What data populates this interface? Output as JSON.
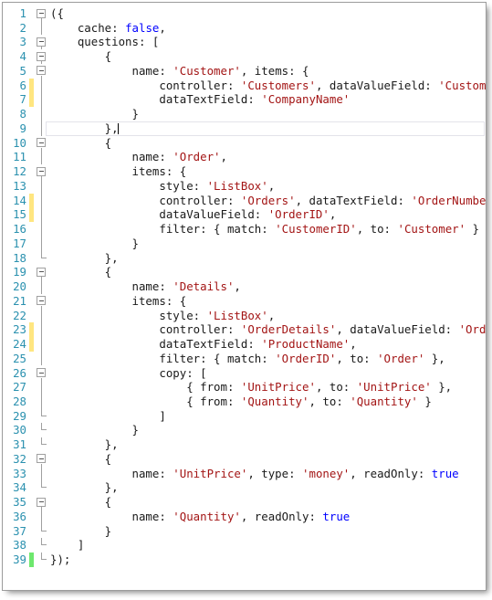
{
  "editor": {
    "language": "javascript",
    "colors": {
      "line_number": "#2b91af",
      "string": "#a31515",
      "keyword": "#0000ff",
      "plain": "#1a1a1a",
      "change_modified": "#ffe680",
      "change_saved": "#6ee86e",
      "current_line_border": "#e3e3ea",
      "background": "#ffffff"
    },
    "cursor": {
      "line": 9,
      "column": 11
    },
    "lines": [
      {
        "n": 1,
        "fold": "box",
        "change": "none",
        "tokens": [
          {
            "t": "({",
            "c": "pl"
          }
        ]
      },
      {
        "n": 2,
        "fold": "line",
        "change": "none",
        "tokens": [
          {
            "t": "    cache: ",
            "c": "pl"
          },
          {
            "t": "false",
            "c": "kw"
          },
          {
            "t": ",",
            "c": "pl"
          }
        ]
      },
      {
        "n": 3,
        "fold": "box",
        "change": "none",
        "tokens": [
          {
            "t": "    questions: [",
            "c": "pl"
          }
        ]
      },
      {
        "n": 4,
        "fold": "box",
        "change": "none",
        "tokens": [
          {
            "t": "        {",
            "c": "pl"
          }
        ]
      },
      {
        "n": 5,
        "fold": "box",
        "change": "none",
        "tokens": [
          {
            "t": "            name: ",
            "c": "pl"
          },
          {
            "t": "'Customer'",
            "c": "str"
          },
          {
            "t": ", items: {",
            "c": "pl"
          }
        ]
      },
      {
        "n": 6,
        "fold": "line",
        "change": "modified",
        "tokens": [
          {
            "t": "                controller: ",
            "c": "pl"
          },
          {
            "t": "'Customers'",
            "c": "str"
          },
          {
            "t": ", dataValueField: ",
            "c": "pl"
          },
          {
            "t": "'CustomerID'",
            "c": "str"
          },
          {
            "t": ",",
            "c": "pl"
          }
        ]
      },
      {
        "n": 7,
        "fold": "line",
        "change": "modified",
        "tokens": [
          {
            "t": "                dataTextField: ",
            "c": "pl"
          },
          {
            "t": "'CompanyName'",
            "c": "str"
          }
        ]
      },
      {
        "n": 8,
        "fold": "line",
        "change": "none",
        "tokens": [
          {
            "t": "            }",
            "c": "pl"
          }
        ]
      },
      {
        "n": 9,
        "fold": "line",
        "change": "none",
        "current": true,
        "tokens": [
          {
            "t": "        },",
            "c": "pl"
          }
        ]
      },
      {
        "n": 10,
        "fold": "box",
        "change": "none",
        "tokens": [
          {
            "t": "        {",
            "c": "pl"
          }
        ]
      },
      {
        "n": 11,
        "fold": "line",
        "change": "none",
        "tokens": [
          {
            "t": "            name: ",
            "c": "pl"
          },
          {
            "t": "'Order'",
            "c": "str"
          },
          {
            "t": ",",
            "c": "pl"
          }
        ]
      },
      {
        "n": 12,
        "fold": "box",
        "change": "none",
        "tokens": [
          {
            "t": "            items: {",
            "c": "pl"
          }
        ]
      },
      {
        "n": 13,
        "fold": "line",
        "change": "none",
        "tokens": [
          {
            "t": "                style: ",
            "c": "pl"
          },
          {
            "t": "'ListBox'",
            "c": "str"
          },
          {
            "t": ",",
            "c": "pl"
          }
        ]
      },
      {
        "n": 14,
        "fold": "line",
        "change": "modified",
        "tokens": [
          {
            "t": "                controller: ",
            "c": "pl"
          },
          {
            "t": "'Orders'",
            "c": "str"
          },
          {
            "t": ", dataTextField: ",
            "c": "pl"
          },
          {
            "t": "'OrderNumber'",
            "c": "str"
          },
          {
            "t": ",",
            "c": "pl"
          }
        ]
      },
      {
        "n": 15,
        "fold": "line",
        "change": "modified",
        "tokens": [
          {
            "t": "                dataValueField: ",
            "c": "pl"
          },
          {
            "t": "'OrderID'",
            "c": "str"
          },
          {
            "t": ",",
            "c": "pl"
          }
        ]
      },
      {
        "n": 16,
        "fold": "line",
        "change": "none",
        "tokens": [
          {
            "t": "                filter: { match: ",
            "c": "pl"
          },
          {
            "t": "'CustomerID'",
            "c": "str"
          },
          {
            "t": ", to: ",
            "c": "pl"
          },
          {
            "t": "'Customer'",
            "c": "str"
          },
          {
            "t": " }",
            "c": "pl"
          }
        ]
      },
      {
        "n": 17,
        "fold": "line",
        "change": "none",
        "tokens": [
          {
            "t": "            }",
            "c": "pl"
          }
        ]
      },
      {
        "n": 18,
        "fold": "end",
        "change": "none",
        "tokens": [
          {
            "t": "        },",
            "c": "pl"
          }
        ]
      },
      {
        "n": 19,
        "fold": "box",
        "change": "none",
        "tokens": [
          {
            "t": "        {",
            "c": "pl"
          }
        ]
      },
      {
        "n": 20,
        "fold": "line",
        "change": "none",
        "tokens": [
          {
            "t": "            name: ",
            "c": "pl"
          },
          {
            "t": "'Details'",
            "c": "str"
          },
          {
            "t": ",",
            "c": "pl"
          }
        ]
      },
      {
        "n": 21,
        "fold": "box",
        "change": "none",
        "tokens": [
          {
            "t": "            items: {",
            "c": "pl"
          }
        ]
      },
      {
        "n": 22,
        "fold": "line",
        "change": "none",
        "tokens": [
          {
            "t": "                style: ",
            "c": "pl"
          },
          {
            "t": "'ListBox'",
            "c": "str"
          },
          {
            "t": ",",
            "c": "pl"
          }
        ]
      },
      {
        "n": 23,
        "fold": "line",
        "change": "modified",
        "tokens": [
          {
            "t": "                controller: ",
            "c": "pl"
          },
          {
            "t": "'OrderDetails'",
            "c": "str"
          },
          {
            "t": ", dataValueField: ",
            "c": "pl"
          },
          {
            "t": "'OrderID'",
            "c": "str"
          },
          {
            "t": ",",
            "c": "pl"
          }
        ]
      },
      {
        "n": 24,
        "fold": "line",
        "change": "modified",
        "tokens": [
          {
            "t": "                dataTextField: ",
            "c": "pl"
          },
          {
            "t": "'ProductName'",
            "c": "str"
          },
          {
            "t": ",",
            "c": "pl"
          }
        ]
      },
      {
        "n": 25,
        "fold": "line",
        "change": "none",
        "tokens": [
          {
            "t": "                filter: { match: ",
            "c": "pl"
          },
          {
            "t": "'OrderID'",
            "c": "str"
          },
          {
            "t": ", to: ",
            "c": "pl"
          },
          {
            "t": "'Order'",
            "c": "str"
          },
          {
            "t": " },",
            "c": "pl"
          }
        ]
      },
      {
        "n": 26,
        "fold": "box",
        "change": "none",
        "tokens": [
          {
            "t": "                copy: [",
            "c": "pl"
          }
        ]
      },
      {
        "n": 27,
        "fold": "line",
        "change": "none",
        "tokens": [
          {
            "t": "                    { from: ",
            "c": "pl"
          },
          {
            "t": "'UnitPrice'",
            "c": "str"
          },
          {
            "t": ", to: ",
            "c": "pl"
          },
          {
            "t": "'UnitPrice'",
            "c": "str"
          },
          {
            "t": " },",
            "c": "pl"
          }
        ]
      },
      {
        "n": 28,
        "fold": "line",
        "change": "none",
        "tokens": [
          {
            "t": "                    { from: ",
            "c": "pl"
          },
          {
            "t": "'Quantity'",
            "c": "str"
          },
          {
            "t": ", to: ",
            "c": "pl"
          },
          {
            "t": "'Quantity'",
            "c": "str"
          },
          {
            "t": " }",
            "c": "pl"
          }
        ]
      },
      {
        "n": 29,
        "fold": "end",
        "change": "none",
        "tokens": [
          {
            "t": "                ]",
            "c": "pl"
          }
        ]
      },
      {
        "n": 30,
        "fold": "end",
        "change": "none",
        "tokens": [
          {
            "t": "            }",
            "c": "pl"
          }
        ]
      },
      {
        "n": 31,
        "fold": "end",
        "change": "none",
        "tokens": [
          {
            "t": "        },",
            "c": "pl"
          }
        ]
      },
      {
        "n": 32,
        "fold": "box",
        "change": "none",
        "tokens": [
          {
            "t": "        {",
            "c": "pl"
          }
        ]
      },
      {
        "n": 33,
        "fold": "line",
        "change": "none",
        "tokens": [
          {
            "t": "            name: ",
            "c": "pl"
          },
          {
            "t": "'UnitPrice'",
            "c": "str"
          },
          {
            "t": ", type: ",
            "c": "pl"
          },
          {
            "t": "'money'",
            "c": "str"
          },
          {
            "t": ", readOnly: ",
            "c": "pl"
          },
          {
            "t": "true",
            "c": "kw"
          }
        ]
      },
      {
        "n": 34,
        "fold": "end",
        "change": "none",
        "tokens": [
          {
            "t": "        },",
            "c": "pl"
          }
        ]
      },
      {
        "n": 35,
        "fold": "box",
        "change": "none",
        "tokens": [
          {
            "t": "        {",
            "c": "pl"
          }
        ]
      },
      {
        "n": 36,
        "fold": "line",
        "change": "none",
        "tokens": [
          {
            "t": "            name: ",
            "c": "pl"
          },
          {
            "t": "'Quantity'",
            "c": "str"
          },
          {
            "t": ", readOnly: ",
            "c": "pl"
          },
          {
            "t": "true",
            "c": "kw"
          }
        ]
      },
      {
        "n": 37,
        "fold": "end",
        "change": "none",
        "tokens": [
          {
            "t": "        }",
            "c": "pl"
          }
        ]
      },
      {
        "n": 38,
        "fold": "end",
        "change": "none",
        "tokens": [
          {
            "t": "    ]",
            "c": "pl"
          }
        ]
      },
      {
        "n": 39,
        "fold": "end",
        "change": "saved",
        "tokens": [
          {
            "t": "});",
            "c": "pl"
          }
        ]
      }
    ]
  }
}
